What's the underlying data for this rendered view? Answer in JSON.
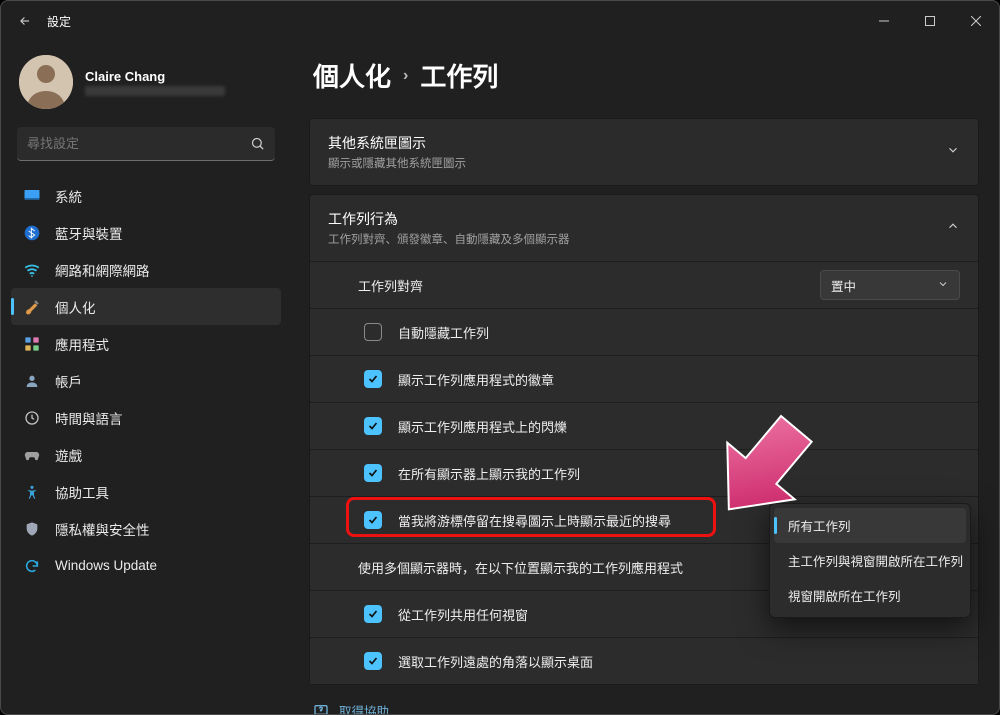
{
  "window": {
    "title": "設定"
  },
  "profile": {
    "name": "Claire Chang"
  },
  "search": {
    "placeholder": "尋找設定"
  },
  "sidebar": {
    "items": [
      {
        "label": "系統"
      },
      {
        "label": "藍牙與裝置"
      },
      {
        "label": "網路和網際網路"
      },
      {
        "label": "個人化"
      },
      {
        "label": "應用程式"
      },
      {
        "label": "帳戶"
      },
      {
        "label": "時間與語言"
      },
      {
        "label": "遊戲"
      },
      {
        "label": "協助工具"
      },
      {
        "label": "隱私權與安全性"
      },
      {
        "label": "Windows Update"
      }
    ]
  },
  "breadcrumb": {
    "root": "個人化",
    "leaf": "工作列"
  },
  "groups": {
    "tray": {
      "title": "其他系統匣圖示",
      "sub": "顯示或隱藏其他系統匣圖示"
    },
    "behavior": {
      "title": "工作列行為",
      "sub": "工作列對齊、頒發徽章、自動隱藏及多個顯示器",
      "alignment": {
        "label": "工作列對齊",
        "value": "置中"
      },
      "rows": [
        {
          "checked": false,
          "label": "自動隱藏工作列"
        },
        {
          "checked": true,
          "label": "顯示工作列應用程式的徽章"
        },
        {
          "checked": true,
          "label": "顯示工作列應用程式上的閃爍"
        },
        {
          "checked": true,
          "label": "在所有顯示器上顯示我的工作列"
        },
        {
          "checked": true,
          "label": "當我將游標停留在搜尋圖示上時顯示最近的搜尋"
        },
        {
          "checked": null,
          "label": "使用多個顯示器時，在以下位置顯示我的工作列應用程式"
        },
        {
          "checked": true,
          "label": "從工作列共用任何視窗"
        },
        {
          "checked": true,
          "label": "選取工作列遠處的角落以顯示桌面"
        }
      ]
    }
  },
  "flyout": {
    "items": [
      {
        "label": "所有工作列",
        "selected": true
      },
      {
        "label": "主工作列與視窗開啟所在工作列",
        "selected": false
      },
      {
        "label": "視窗開啟所在工作列",
        "selected": false
      }
    ]
  },
  "help": {
    "label": "取得協助"
  }
}
